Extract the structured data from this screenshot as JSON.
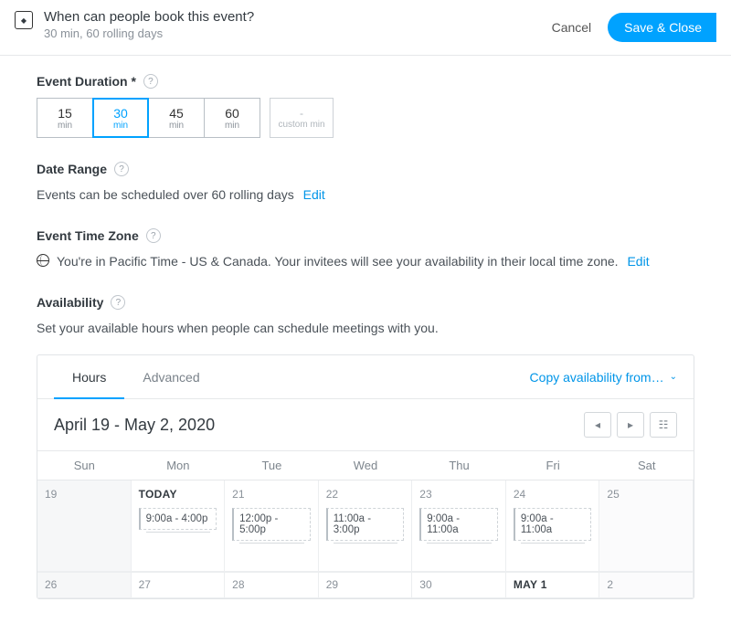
{
  "header": {
    "title": "When can people book this event?",
    "subtitle": "30 min, 60 rolling days",
    "cancel": "Cancel",
    "save": "Save & Close"
  },
  "duration": {
    "label": "Event Duration *",
    "options": [
      {
        "value": "15",
        "unit": "min"
      },
      {
        "value": "30",
        "unit": "min"
      },
      {
        "value": "45",
        "unit": "min"
      },
      {
        "value": "60",
        "unit": "min"
      }
    ],
    "custom": {
      "value": "-",
      "unit": "custom min"
    },
    "selected": "30"
  },
  "dateRange": {
    "label": "Date Range",
    "text": "Events can be scheduled over 60 rolling days",
    "edit": "Edit"
  },
  "timezone": {
    "label": "Event Time Zone",
    "text": "You're in Pacific Time - US & Canada. Your invitees will see your availability in their local time zone.",
    "edit": "Edit"
  },
  "availability": {
    "label": "Availability",
    "text": "Set your available hours when people can schedule meetings with you."
  },
  "tabs": {
    "hours": "Hours",
    "advanced": "Advanced",
    "copy": "Copy availability from…"
  },
  "calendar": {
    "range": "April 19 - May 2, 2020",
    "weekdays": [
      "Sun",
      "Mon",
      "Tue",
      "Wed",
      "Thu",
      "Fri",
      "Sat"
    ],
    "row1": [
      {
        "label": "19",
        "bold": false,
        "slot": null
      },
      {
        "label": "TODAY",
        "bold": true,
        "slot": "9:00a - 4:00p"
      },
      {
        "label": "21",
        "bold": false,
        "slot": "12:00p - 5:00p"
      },
      {
        "label": "22",
        "bold": false,
        "slot": "11:00a - 3:00p"
      },
      {
        "label": "23",
        "bold": false,
        "slot": "9:00a - 11:00a"
      },
      {
        "label": "24",
        "bold": false,
        "slot": "9:00a - 11:00a"
      },
      {
        "label": "25",
        "bold": false,
        "slot": null
      }
    ],
    "row2": [
      {
        "label": "26",
        "bold": false
      },
      {
        "label": "27",
        "bold": false
      },
      {
        "label": "28",
        "bold": false
      },
      {
        "label": "29",
        "bold": false
      },
      {
        "label": "30",
        "bold": false
      },
      {
        "label": "MAY 1",
        "bold": true
      },
      {
        "label": "2",
        "bold": false
      }
    ]
  }
}
